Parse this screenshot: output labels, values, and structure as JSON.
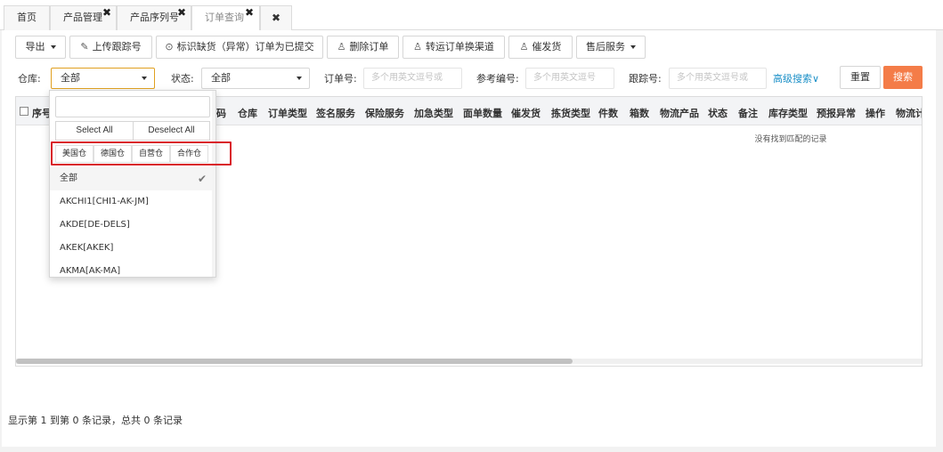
{
  "tabs": [
    {
      "label": "首页"
    },
    {
      "label": "产品管理"
    },
    {
      "label": "产品序列号"
    },
    {
      "label": "订单查询"
    }
  ],
  "tab_close_glyph": "✖",
  "toolbar": {
    "export": "导出",
    "upload_tracking": "上传跟踪号",
    "mark_shortage": "标识缺货（异常）订单为已提交",
    "delete_order": "删除订单",
    "transfer_channel": "转运订单换渠道",
    "urge_shipment": "催发货",
    "after_sales": "售后服务"
  },
  "filters": {
    "warehouse_label": "仓库:",
    "warehouse_value": "全部",
    "status_label": "状态:",
    "status_value": "全部",
    "order_no_label": "订单号:",
    "order_no_placeholder": "多个用英文逗号或",
    "ref_no_label": "参考编号:",
    "ref_no_placeholder": "多个用英文逗号",
    "tracking_label": "跟踪号:",
    "tracking_placeholder": "多个用英文逗号或",
    "advanced_search": "高级搜索∨",
    "reset": "重置",
    "search": "搜索"
  },
  "table": {
    "columns": [
      "序号",
      "码",
      "仓库",
      "订单类型",
      "签名服务",
      "保险服务",
      "加急类型",
      "面单数量",
      "催发货",
      "拣货类型",
      "件数",
      "箱数",
      "物流产品",
      "状态",
      "备注",
      "库存类型",
      "预报异常",
      "操作",
      "物流计"
    ],
    "empty_text": "没有找到匹配的记录"
  },
  "footer": "显示第 1 到第 0 条记录，总共 0 条记录",
  "dropdown": {
    "select_all": "Select All",
    "deselect_all": "Deselect All",
    "groups": [
      "美国仓",
      "德国仓",
      "自营仓",
      "合作仓"
    ],
    "items": [
      "全部",
      "AKCHI1[CHI1-AK-JM]",
      "AKDE[DE-DELS]",
      "AKEK[AKEK]",
      "AKMA[AK-MA]"
    ],
    "selected_index": 0
  },
  "colors": {
    "accent_orange": "#f47c48",
    "link_blue": "#1a8fc7",
    "highlight_red": "#d9202a",
    "focus_border": "#e0a020"
  }
}
